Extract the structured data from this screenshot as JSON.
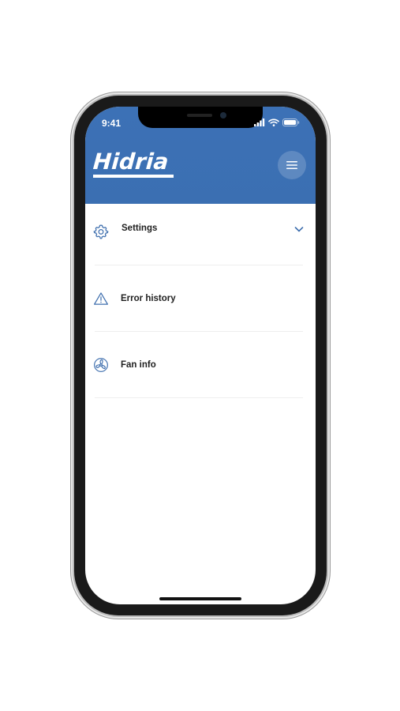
{
  "status_bar": {
    "time": "9:41"
  },
  "header": {
    "logo_text": "Hidria",
    "menu_icon": "hamburger-icon",
    "color": "#3c71b6"
  },
  "menu": {
    "items": [
      {
        "label": "Settings",
        "icon": "gear-icon",
        "expandable": true
      },
      {
        "label": "Error history",
        "icon": "warning-icon"
      },
      {
        "label": "Fan info",
        "icon": "fan-icon"
      }
    ]
  },
  "colors": {
    "accent": "#3c71b6",
    "icon_stroke": "#3f6fae",
    "text": "#1e1e1e",
    "divider": "#eeeeee"
  }
}
